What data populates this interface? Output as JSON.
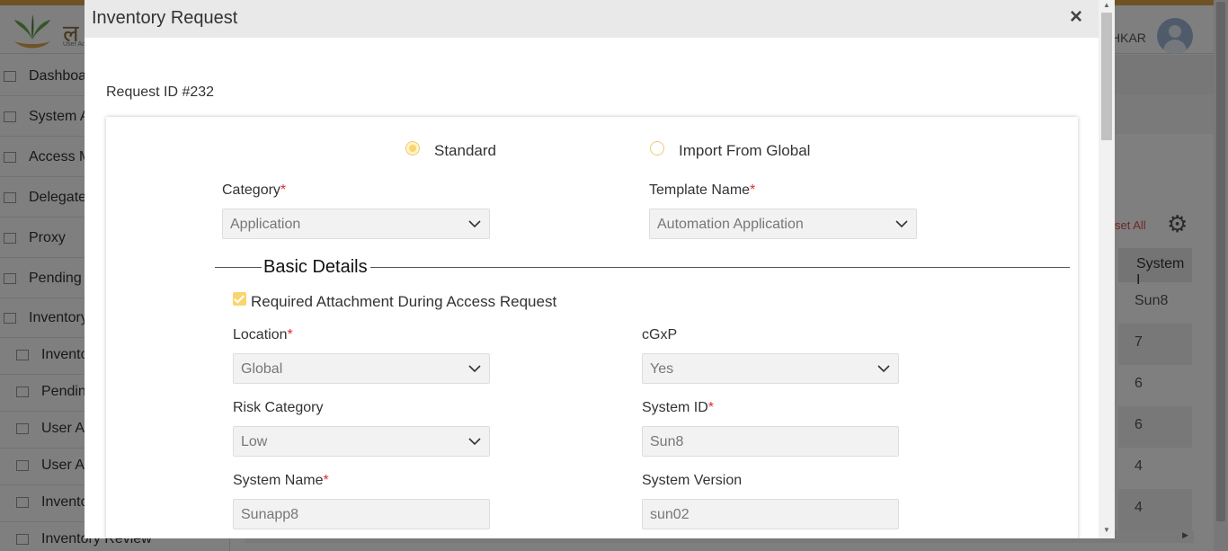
{
  "background": {
    "user_name_fragment": "HKAR",
    "sidebar_items": [
      {
        "label": "Dashboard",
        "sub": false
      },
      {
        "label": "System Admin",
        "sub": false
      },
      {
        "label": "Access Management",
        "sub": false
      },
      {
        "label": "Delegate",
        "sub": false
      },
      {
        "label": "Proxy",
        "sub": false
      },
      {
        "label": "Pending",
        "sub": false
      },
      {
        "label": "Inventory",
        "sub": false
      },
      {
        "label": "Inventory",
        "sub": true
      },
      {
        "label": "Pending",
        "sub": true
      },
      {
        "label": "User Access",
        "sub": true
      },
      {
        "label": "User Access",
        "sub": true
      },
      {
        "label": "Inventory",
        "sub": true
      },
      {
        "label": "Inventory Review",
        "sub": true
      }
    ],
    "reset_all_fragment": "set All",
    "table_header": "System I",
    "table_values": [
      "Sun8",
      "7",
      "6",
      "6",
      "4",
      "4"
    ]
  },
  "modal": {
    "title": "Inventory Request",
    "close_icon": "close-icon",
    "request_id": "Request ID #232",
    "radio_options": [
      {
        "label": "Standard",
        "checked": true
      },
      {
        "label": "Import From Global",
        "checked": false
      }
    ],
    "category": {
      "label": "Category",
      "required": "*",
      "value": "Application"
    },
    "template_name": {
      "label": "Template Name",
      "required": "*",
      "value": "Automation Application"
    },
    "section_title": "Basic Details",
    "attachment_checkbox": {
      "label": "Required Attachment During Access Request",
      "checked": true
    },
    "location": {
      "label": "Location",
      "required": "*",
      "value": "Global"
    },
    "cgxp": {
      "label": "cGxP",
      "value": "Yes"
    },
    "risk_category": {
      "label": "Risk Category",
      "value": "Low"
    },
    "system_id": {
      "label": "System ID",
      "required": "*",
      "value": "Sun8"
    },
    "system_name": {
      "label": "System Name",
      "required": "*",
      "value": "Sunapp8"
    },
    "system_version": {
      "label": "System Version",
      "value": "sun02"
    }
  },
  "colors": {
    "accent": "#fad56d",
    "required": "#d9302c",
    "top_bar": "#e0a44a"
  }
}
